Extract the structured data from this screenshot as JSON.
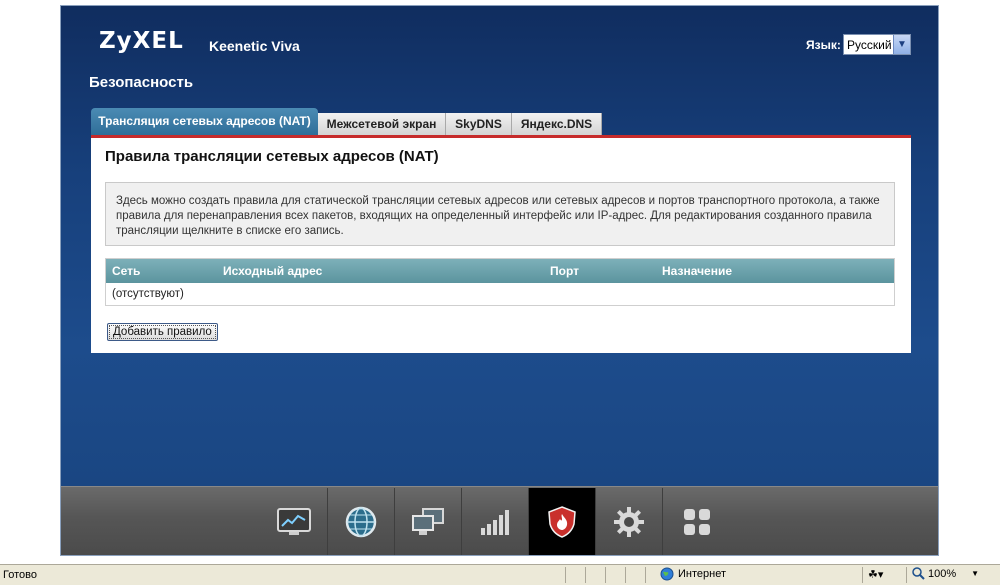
{
  "header": {
    "brand": "ZyXEL",
    "model": "Keenetic Viva",
    "language_label": "Язык:",
    "language_value": "Русский"
  },
  "page": {
    "title": "Безопасность"
  },
  "tabs": [
    {
      "label": "Трансляция сетевых адресов (NAT)",
      "active": true
    },
    {
      "label": "Межсетевой экран",
      "active": false
    },
    {
      "label": "SkyDNS",
      "active": false
    },
    {
      "label": "Яндекс.DNS",
      "active": false
    }
  ],
  "panel": {
    "heading": "Правила трансляции сетевых адресов (NAT)",
    "info": "Здесь можно создать правила для статической трансляции сетевых адресов или сетевых адресов и портов транспортного протокола, а также правила для перенаправления всех пакетов, входящих на определенный интерфейс или IP-адрес. Для редактирования созданного правила трансляции щелкните в списке его запись.",
    "table": {
      "columns": [
        "Сеть",
        "Исходный адрес",
        "Порт",
        "Назначение"
      ],
      "empty_row": "(отсутствуют)"
    },
    "add_button": "Добавить правило"
  },
  "dock": {
    "items": [
      {
        "icon": "monitor-chart-icon",
        "active": false
      },
      {
        "icon": "globe-icon",
        "active": false
      },
      {
        "icon": "network-computers-icon",
        "active": false
      },
      {
        "icon": "signal-bars-icon",
        "active": false
      },
      {
        "icon": "security-shield-icon",
        "active": true
      },
      {
        "icon": "gear-icon",
        "active": false
      },
      {
        "icon": "apps-grid-icon",
        "active": false
      }
    ]
  },
  "statusbar": {
    "status": "Готово",
    "zone": "Интернет",
    "zoom": "100%"
  },
  "colors": {
    "background": "#17407c",
    "tab_active": "#3a7aa5",
    "accent_line": "#c62b2b",
    "table_header": "#6aa1ab"
  }
}
